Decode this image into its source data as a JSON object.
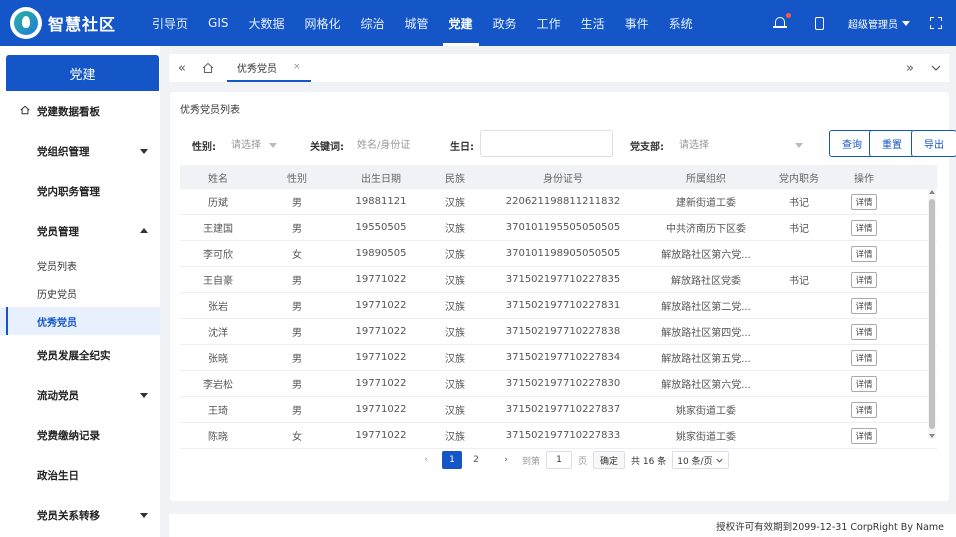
{
  "brand": {
    "name": "智慧社区"
  },
  "nav": [
    "引导页",
    "GIS",
    "大数据",
    "网格化",
    "综治",
    "城管",
    "党建",
    "政务",
    "工作",
    "生活",
    "事件",
    "系统"
  ],
  "nav_active": 6,
  "user": {
    "name": "超级管理员"
  },
  "sidebar": {
    "header": "党建",
    "items": [
      {
        "label": "党建数据看板",
        "icon": "home-icon",
        "arrow": ""
      },
      {
        "label": "党组织管理",
        "arrow": "down"
      },
      {
        "label": "党内职务管理",
        "arrow": ""
      },
      {
        "label": "党员管理",
        "arrow": "up"
      }
    ],
    "subitems": [
      {
        "label": "党员列表",
        "active": false
      },
      {
        "label": "历史党员",
        "active": false
      },
      {
        "label": "优秀党员",
        "active": true
      }
    ],
    "items2": [
      {
        "label": "党员发展全纪实",
        "arrow": ""
      },
      {
        "label": "流动党员",
        "arrow": "down"
      },
      {
        "label": "党费缴纳记录",
        "arrow": ""
      },
      {
        "label": "政治生日",
        "arrow": ""
      },
      {
        "label": "党员关系转移",
        "arrow": "down"
      }
    ]
  },
  "tabs": {
    "active_label": "优秀党员",
    "close": "×"
  },
  "card": {
    "title": "优秀党员列表"
  },
  "filters": {
    "gender_label": "性别:",
    "gender_placeholder": "请选择",
    "keyword_label": "关键词:",
    "keyword_placeholder": "姓名/身份证",
    "birthday_label": "生日:",
    "branch_label": "党支部:",
    "branch_placeholder": "请选择",
    "query": "查询",
    "reset": "重置",
    "export": "导出"
  },
  "table": {
    "headers": [
      "姓名",
      "性别",
      "出生日期",
      "民族",
      "身份证号",
      "所属组织",
      "党内职务",
      "操作"
    ],
    "rows": [
      [
        "历斌",
        "男",
        "19881121",
        "汉族",
        "220621198811211832",
        "建新街道工委",
        "书记",
        "详情"
      ],
      [
        "王建国",
        "男",
        "19550505",
        "汉族",
        "370101195505050505",
        "中共济南历下区委",
        "书记",
        "详情"
      ],
      [
        "李可欣",
        "女",
        "19890505",
        "汉族",
        "370101198905050505",
        "解放路社区第六党...",
        "",
        "详情"
      ],
      [
        "王自豪",
        "男",
        "19771022",
        "汉族",
        "371502197710227835",
        "解放路社区党委",
        "书记",
        "详情"
      ],
      [
        "张岩",
        "男",
        "19771022",
        "汉族",
        "371502197710227831",
        "解放路社区第二党...",
        "",
        "详情"
      ],
      [
        "沈洋",
        "男",
        "19771022",
        "汉族",
        "371502197710227838",
        "解放路社区第四党...",
        "",
        "详情"
      ],
      [
        "张晓",
        "男",
        "19771022",
        "汉族",
        "371502197710227834",
        "解放路社区第五党...",
        "",
        "详情"
      ],
      [
        "李岩松",
        "男",
        "19771022",
        "汉族",
        "371502197710227830",
        "解放路社区第六党...",
        "",
        "详情"
      ],
      [
        "王琦",
        "男",
        "19771022",
        "汉族",
        "371502197710227837",
        "姚家街道工委",
        "",
        "详情"
      ],
      [
        "陈晓",
        "女",
        "19771022",
        "汉族",
        "371502197710227833",
        "姚家街道工委",
        "",
        "详情"
      ]
    ]
  },
  "pager": {
    "prev": "‹",
    "pages": [
      "1",
      "2"
    ],
    "active": "1",
    "next": "›",
    "goto": "到第",
    "goto_value": "1",
    "page_unit": "页",
    "confirm": "确定",
    "total": "共 16 条",
    "size": "10 条/页"
  },
  "footer": "授权许可有效期到2099-12-31 CorpRight By Name"
}
